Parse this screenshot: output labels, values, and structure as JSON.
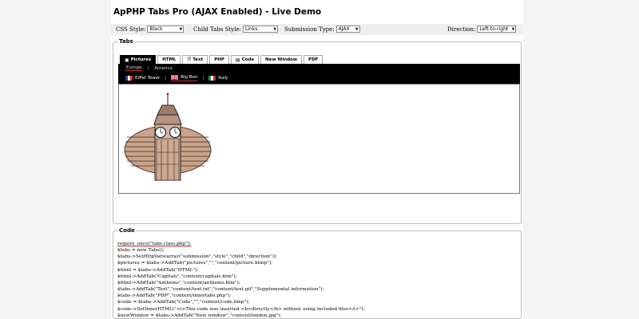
{
  "header": {
    "title": "ApPHP Tabs Pro (AJAX Enabled) - Live Demo"
  },
  "settings": {
    "css_style": {
      "label": "CSS Style:",
      "value": "Black"
    },
    "child_tabs_style": {
      "label": "Child Tabs Style:",
      "value": "Links"
    },
    "submission_type": {
      "label": "Submission Type:",
      "value": "AJAX"
    },
    "direction": {
      "label": "Direction:",
      "value": "Left-to-right"
    }
  },
  "tabs_section": {
    "legend": "Tabs",
    "tabs": [
      {
        "label": "Pictures",
        "icon": "image-icon"
      },
      {
        "label": "HTML"
      },
      {
        "label": "Text",
        "icon": "text-file-icon"
      },
      {
        "label": "PHP"
      },
      {
        "label": "Code",
        "icon": "code-file-icon"
      },
      {
        "label": "New Window"
      },
      {
        "label": "PDF"
      }
    ],
    "subtabs": [
      {
        "label": "Europe"
      },
      {
        "label": "America"
      }
    ],
    "childtabs": [
      {
        "label": "Eiffel Tower",
        "flag": "france-flag-icon"
      },
      {
        "label": "Big Ben",
        "flag": "uk-flag-icon"
      },
      {
        "label": "Italy",
        "flag": "italy-flag-icon"
      }
    ]
  },
  "code_section": {
    "legend": "Code",
    "lines": [
      "require_once(\"tabs.class.php\");",
      "$tabs = new Tabs();",
      "$tabs->SetHttpVars(array(\"submission\",\"style\",\"child\",\"direction\"));",
      "$pictures = $tabs->AddTab(\"pictures\",\"\",\"content/picture.htmp\");",
      "$html = $tabs->AddTab(\"HTML\");",
      "$html->AddTab(\"Capitals\",\"content/capitals.htm\");",
      "$html->AddTab(\"Anthems\",\"content/anthems.htm\");",
      "$tabs->AddTab(\"Text\",\"content/text.txt\",\"content/text.gif\",\"Supplemental information\");",
      "$tabs->AddTab(\"PHP\",\"content/innertabs.php\");",
      "$code = $tabs->AddTab(\"Code\",\"\",\"content/code.bmp\");",
      "$code->SetInnerHTML(\"<i>This code was inserted <b>directly</b> without using included files</i>\");",
      "$newWindow = $tabs->AddTab(\"New window\",\"content/london.jpg\");"
    ]
  }
}
